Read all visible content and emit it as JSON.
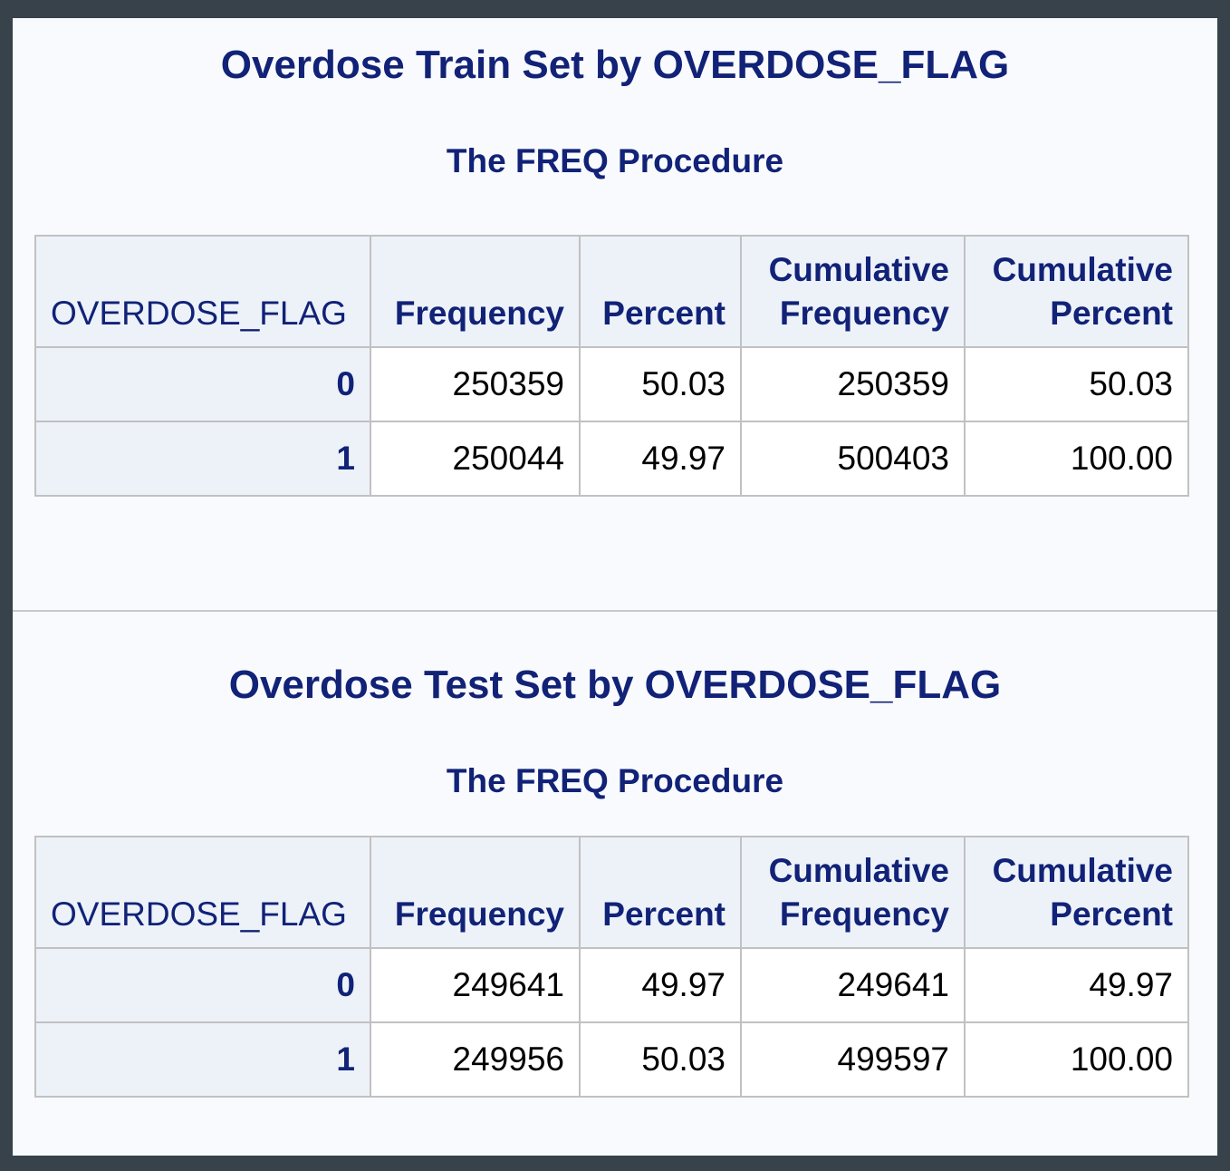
{
  "train": {
    "title": "Overdose Train Set by OVERDOSE_FLAG",
    "subtitle": "The FREQ Procedure",
    "headers": {
      "flag": "OVERDOSE_FLAG",
      "frequency": "Frequency",
      "percent": "Percent",
      "cum_freq_line1": "Cumulative",
      "cum_freq_line2": "Frequency",
      "cum_pct_line1": "Cumulative",
      "cum_pct_line2": "Percent"
    },
    "rows": [
      {
        "flag": "0",
        "frequency": "250359",
        "percent": "50.03",
        "cum_freq": "250359",
        "cum_pct": "50.03"
      },
      {
        "flag": "1",
        "frequency": "250044",
        "percent": "49.97",
        "cum_freq": "500403",
        "cum_pct": "100.00"
      }
    ]
  },
  "test": {
    "title": "Overdose Test Set by OVERDOSE_FLAG",
    "subtitle": "The FREQ Procedure",
    "headers": {
      "flag": "OVERDOSE_FLAG",
      "frequency": "Frequency",
      "percent": "Percent",
      "cum_freq_line1": "Cumulative",
      "cum_freq_line2": "Frequency",
      "cum_pct_line1": "Cumulative",
      "cum_pct_line2": "Percent"
    },
    "rows": [
      {
        "flag": "0",
        "frequency": "249641",
        "percent": "49.97",
        "cum_freq": "249641",
        "cum_pct": "49.97"
      },
      {
        "flag": "1",
        "frequency": "249956",
        "percent": "50.03",
        "cum_freq": "499597",
        "cum_pct": "100.00"
      }
    ]
  },
  "colors": {
    "title_text": "#112277",
    "header_bg": "#edf2f9",
    "page_bg": "#f9fafd",
    "outer_bg": "#37424b"
  }
}
